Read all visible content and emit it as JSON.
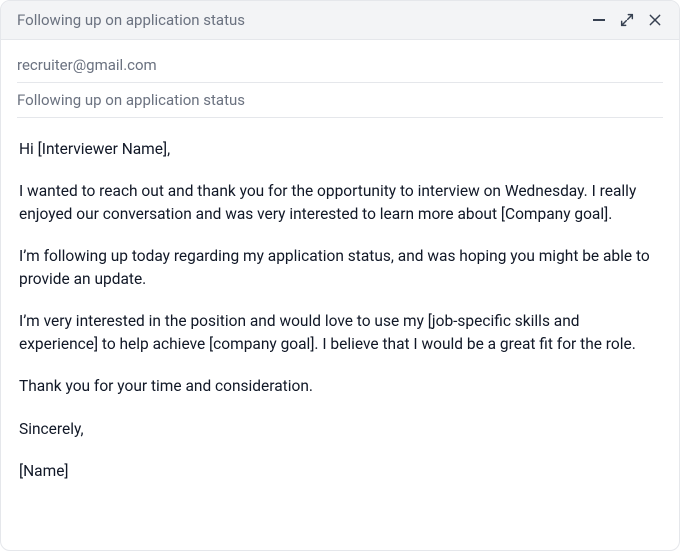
{
  "window": {
    "title": "Following up on application status"
  },
  "fields": {
    "to": "recruiter@gmail.com",
    "subject": "Following up on application status"
  },
  "body": {
    "p1": "Hi [Interviewer Name],",
    "p2": "I wanted to reach out and thank you for the opportunity to interview on Wednesday. I really enjoyed our conversation and was very interested to learn more about [Company goal].",
    "p3": "I’m following up today regarding my application status, and was hoping you might be able to provide an update.",
    "p4": "I’m very interested in the position and would love to use my [job-specific skills and experience] to help achieve [company goal]. I believe that I would be a great fit for the role.",
    "p5": "Thank you for your time and consideration.",
    "p6": "Sincerely,",
    "p7": "[Name]"
  }
}
